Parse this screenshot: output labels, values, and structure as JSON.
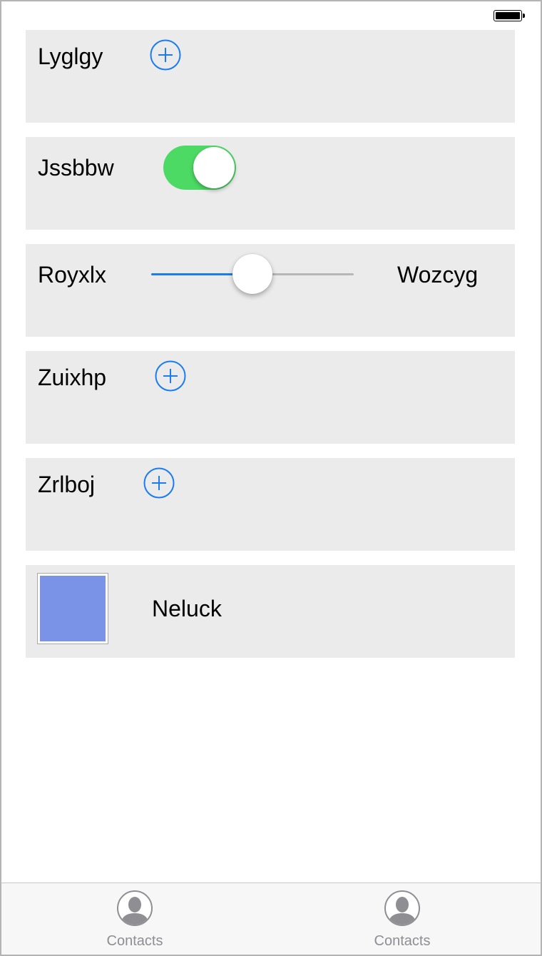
{
  "colors": {
    "card_background": "#ebebeb",
    "accent_blue": "#1a7cf0",
    "toggle_on_green": "#4cd964",
    "image_swatch": "#7b93e6",
    "tab_inactive": "#8e8e93"
  },
  "status_bar": {
    "battery_icon": "battery-full-icon"
  },
  "rows": {
    "lyglgy": {
      "label": "Lyglgy",
      "control": "add-circle-icon"
    },
    "jssbbw": {
      "label": "Jssbbw",
      "control": "toggle",
      "toggle_on": true
    },
    "royxlx": {
      "label": "Royxlx",
      "control": "slider",
      "slider_value": 0.5,
      "trailing_label": "Wozcyg"
    },
    "zuixhp": {
      "label": "Zuixhp",
      "control": "add-circle-icon"
    },
    "zrlboj": {
      "label": "Zrlboj",
      "control": "add-circle-icon"
    },
    "neluck": {
      "label": "Neluck",
      "control": "image-thumbnail"
    }
  },
  "tab_bar": {
    "tabs": [
      {
        "label": "Contacts",
        "icon": "contact-person-icon"
      },
      {
        "label": "Contacts",
        "icon": "contact-person-icon"
      }
    ]
  }
}
